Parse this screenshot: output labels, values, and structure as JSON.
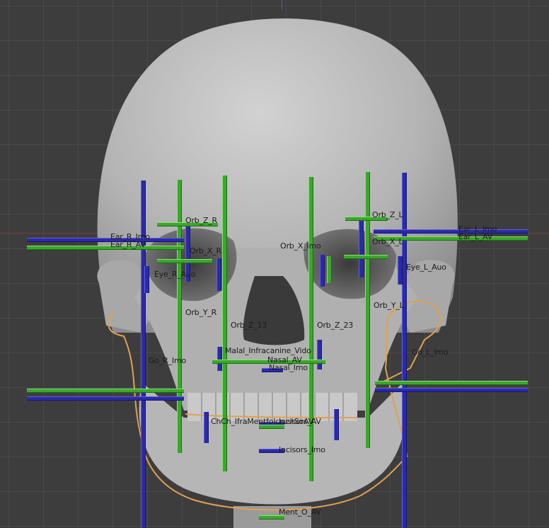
{
  "viewport": {
    "name": "3D Viewport"
  },
  "colors": {
    "background": "#3d3d3d",
    "grid": "#4a4a4a",
    "bone": "#b8b8b8",
    "guide_blue": "#2b2aa8",
    "guide_green": "#3aa82a",
    "outline": "#e0a050"
  },
  "labels": {
    "orb_z_r": "Orb_Z_R",
    "orb_z_l": "Orb_Z_L",
    "orb_x_r": "Orb_X_R",
    "orb_x_mid": "Orb_X_Imo",
    "orb_x_l": "Orb_X_L",
    "ear_r_imo": "Ear_R_Imo",
    "ear_r_av": "Ear_R_AV",
    "ear_l_imo": "Ear_L_Imo",
    "ear_l_av": "Ear_L_AV",
    "eye_r": "Eye_R_Auo",
    "eye_l": "Eye_L_Auo",
    "orb_y_r": "Orb_Y_R",
    "orb_y_l": "Orb_Y_L",
    "orb_z_13": "Orb_Z_13",
    "orb_z_23": "Orb_Z_23",
    "go_r": "Go_R_Imo",
    "go_l": "Go_L_Imo",
    "malar": "Malal_Infracanine_Vido",
    "nasal_av": "Nasal_AV",
    "nasal_imo": "Nasal_Imo",
    "chin_infra": "ChCh_IfraMentfolcrustSoAV",
    "incisors_av": "Incisors_AV",
    "incisors_imo": "Incisors_Imo",
    "ment_av": "Ment_O_AV"
  }
}
